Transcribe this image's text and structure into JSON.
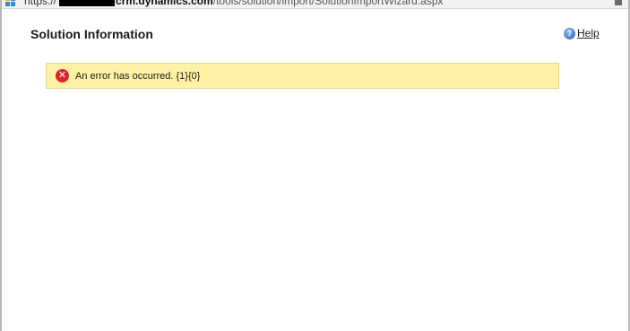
{
  "browser": {
    "url_prefix": "https://",
    "url_host": "crm.dynamics.com",
    "url_path": "/tools/solution/import/SolutionImportWizard.aspx"
  },
  "dialog": {
    "title": "Solution Information",
    "help_label": "Help",
    "help_icon": "help-question-icon"
  },
  "error": {
    "icon": "error-x-icon",
    "message": "An error has occurred. {1}{0}",
    "colors": {
      "banner_bg": "#fff2a5",
      "icon_bg": "#d9232e"
    }
  }
}
